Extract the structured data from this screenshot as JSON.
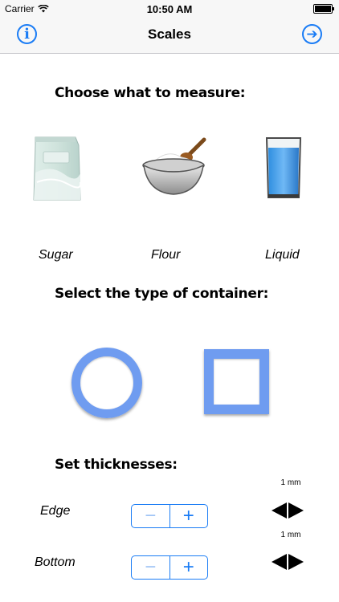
{
  "status_bar": {
    "carrier": "Carrier",
    "time": "10:50 AM"
  },
  "nav": {
    "title": "Scales",
    "info_icon_glyph": "i",
    "next_icon_glyph": "➔"
  },
  "sections": {
    "measure_heading": "Choose what to measure:",
    "container_heading": "Select the type of container:",
    "thickness_heading": "Set thicknesses:"
  },
  "measure_options": [
    {
      "label": "Sugar",
      "icon": "sugar-bag-icon"
    },
    {
      "label": "Flour",
      "icon": "flour-bowl-icon"
    },
    {
      "label": "Liquid",
      "icon": "water-glass-icon"
    }
  ],
  "containers": [
    {
      "icon": "round-container-icon"
    },
    {
      "icon": "square-container-icon"
    }
  ],
  "thickness": {
    "edge": {
      "label": "Edge",
      "value": "1 mm"
    },
    "bottom": {
      "label": "Bottom",
      "value": "1 mm"
    },
    "minus_glyph": "−",
    "plus_glyph": "+"
  },
  "colors": {
    "accent": "#1a7cf5",
    "container_blue": "#6f9cf0"
  }
}
